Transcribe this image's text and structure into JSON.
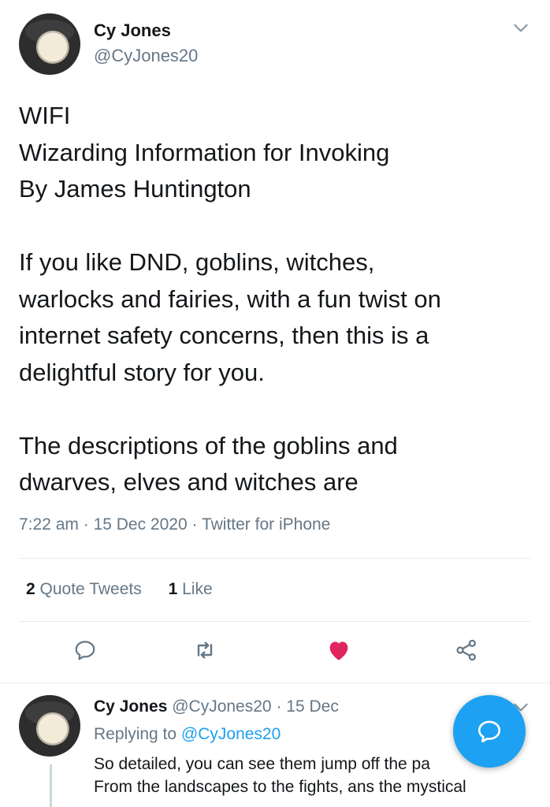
{
  "tweet": {
    "author_name": "Cy Jones",
    "author_handle": "@CyJones20",
    "body_lines": [
      "WIFI",
      "Wizarding Information for Invoking",
      "By James Huntington",
      "",
      "If you like DND, goblins, witches,",
      "warlocks and fairies, with a fun twist on",
      "internet safety concerns, then this is a",
      "delightful story for you.",
      "",
      "The descriptions of the goblins and",
      "dwarves, elves and witches are"
    ],
    "time": "7:22 am",
    "date": "15 Dec 2020",
    "source": "Twitter for iPhone",
    "quote_tweets_count": "2",
    "quote_tweets_label": "Quote Tweets",
    "likes_count": "1",
    "likes_label": "Like",
    "liked": true
  },
  "actions": {
    "icons": [
      "reply-icon",
      "retweet-icon",
      "like-icon",
      "share-icon"
    ]
  },
  "reply": {
    "author_name": "Cy Jones",
    "author_handle": "@CyJones20",
    "date": "15 Dec",
    "replying_to_label": "Replying to",
    "replying_to_handle": "@CyJones20",
    "text_line1": "So detailed, you can see them jump off the pa",
    "text_line2": "From the landscapes to the fights, ans the mystical"
  },
  "colors": {
    "accent": "#1da1f2",
    "like": "#e0245e",
    "secondary_text": "#657786"
  },
  "compose_button": {
    "icon": "compose-reply-icon"
  }
}
